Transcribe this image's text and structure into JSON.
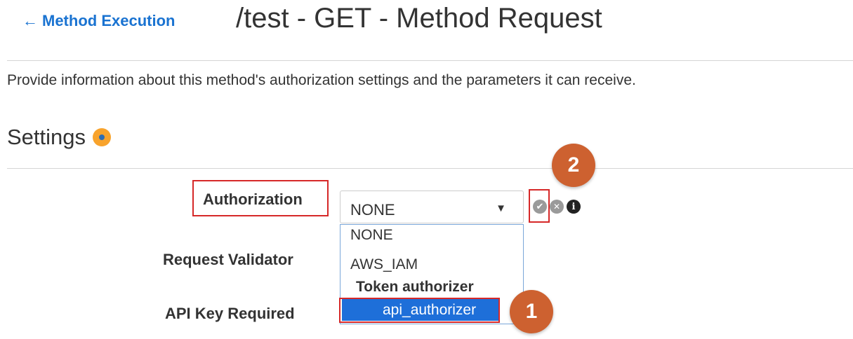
{
  "header": {
    "back_arrow": "←",
    "back_label": "Method Execution",
    "title": "/test - GET - Method Request"
  },
  "description": "Provide information about this method's authorization settings and the parameters it can receive.",
  "settings": {
    "title": "Settings",
    "status_dot_color": "#f8a32c"
  },
  "form": {
    "authorization_label": "Authorization",
    "request_validator_label": "Request Validator",
    "api_key_required_label": "API Key Required",
    "authorization_select": {
      "value": "NONE",
      "caret": "▼",
      "options": [
        {
          "label": "NONE"
        },
        {
          "label": "AWS_IAM"
        }
      ],
      "group_label": "Token authorizer",
      "selected_option": "api_authorizer"
    },
    "actions": {
      "confirm_icon": "✔",
      "cancel_icon": "✕",
      "info_icon": "i"
    }
  },
  "annotations": {
    "step_1": "1",
    "step_2": "2",
    "highlight_color": "#d62828",
    "badge_color": "#cd6130"
  },
  "colors": {
    "link": "#1a73d1",
    "selected_option_bg": "#1e6fd9"
  }
}
